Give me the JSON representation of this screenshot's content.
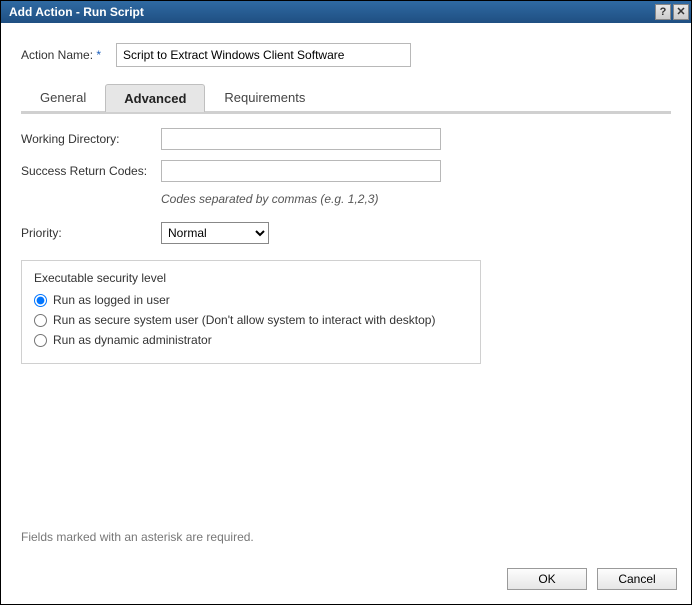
{
  "titlebar": {
    "title": "Add Action - Run Script",
    "help_symbol": "?",
    "close_symbol": "✕"
  },
  "actionName": {
    "label": "Action Name:",
    "required_marker": "*",
    "value": "Script to Extract Windows Client Software"
  },
  "tabs": {
    "general": "General",
    "advanced": "Advanced",
    "requirements": "Requirements",
    "active": "advanced"
  },
  "advanced": {
    "workingDir": {
      "label": "Working Directory:",
      "value": ""
    },
    "returnCodes": {
      "label": "Success Return Codes:",
      "value": "",
      "hint": "Codes separated by commas (e.g. 1,2,3)"
    },
    "priority": {
      "label": "Priority:",
      "selected": "Normal",
      "options": [
        "Normal"
      ]
    },
    "securityLevel": {
      "legend": "Executable security level",
      "options": [
        "Run as logged in user",
        "Run as secure system user (Don't allow system to interact with desktop)",
        "Run as dynamic administrator"
      ],
      "selected_index": 0
    }
  },
  "footer": {
    "note": "Fields marked with an asterisk are required.",
    "ok": "OK",
    "cancel": "Cancel"
  }
}
